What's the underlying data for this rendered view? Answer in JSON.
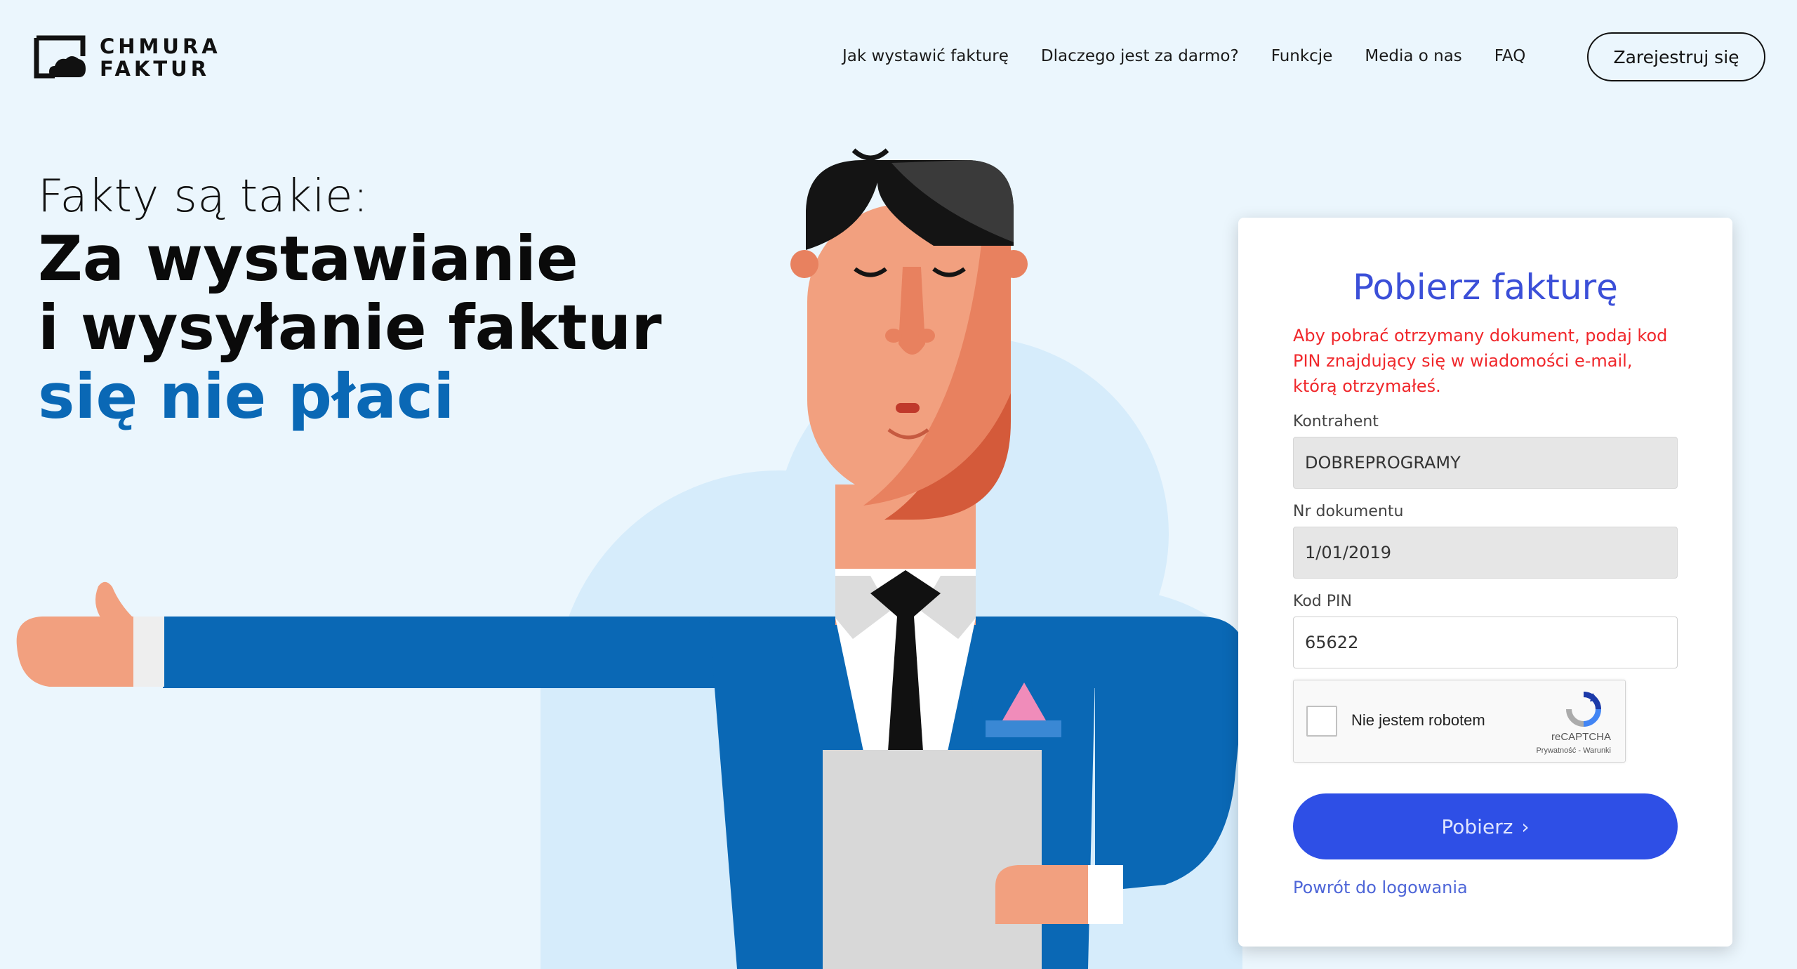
{
  "brand": {
    "line1": "CHMURA",
    "line2": "FAKTUR"
  },
  "nav": {
    "items": [
      "Jak wystawić fakturę",
      "Dlaczego jest za darmo?",
      "Funkcje",
      "Media o nas",
      "FAQ"
    ],
    "register_label": "Zarejestruj się"
  },
  "hero": {
    "subtitle": "Fakty są takie:",
    "line1": "Za wystawianie",
    "line2": "i wysyłanie faktur",
    "line3": "się nie płaci"
  },
  "form": {
    "title": "Pobierz fakturę",
    "message": "Aby pobrać otrzymany dokument, podaj kod PIN znajdujący się w wiadomości e-mail, którą otrzymałeś.",
    "contractor_label": "Kontrahent",
    "contractor_value": "DOBREPROGRAMY",
    "doc_label": "Nr dokumentu",
    "doc_value": "1/01/2019",
    "pin_label": "Kod PIN",
    "pin_value": "65622",
    "captcha_label": "Nie jestem robotem",
    "captcha_brand": "reCAPTCHA",
    "captcha_links": "Prywatność - Warunki",
    "submit_label": "Pobierz",
    "submit_arrow": "›",
    "back_link": "Powrót do logowania"
  },
  "colors": {
    "background": "#ebf6fd",
    "accent_blue": "#0a68b5",
    "button_blue": "#2e4fe6",
    "title_blue": "#3b4fd8",
    "error_red": "#f0272b"
  }
}
